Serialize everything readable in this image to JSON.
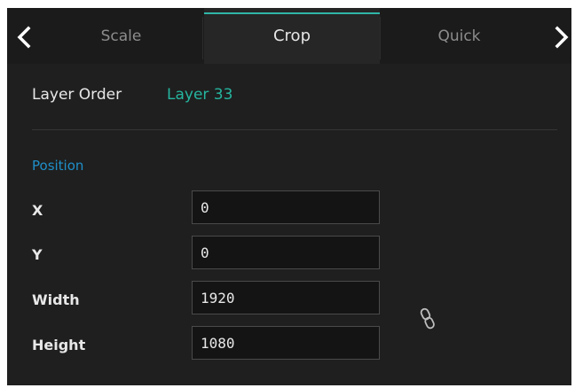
{
  "tabs": [
    {
      "label": "Scale",
      "active": false
    },
    {
      "label": "Crop",
      "active": true
    },
    {
      "label": "Quick",
      "active": false
    }
  ],
  "layer_order": {
    "label": "Layer Order",
    "value": "Layer 33"
  },
  "position": {
    "title": "Position",
    "fields": {
      "x": {
        "label": "X",
        "value": "0"
      },
      "y": {
        "label": "Y",
        "value": "0"
      },
      "width": {
        "label": "Width",
        "value": "1920"
      },
      "height": {
        "label": "Height",
        "value": "1080"
      }
    }
  },
  "icons": {
    "prev": "chevron-left-icon",
    "next": "chevron-right-icon",
    "link": "chain-link-icon"
  },
  "colors": {
    "background": "#1f1f1f",
    "tab_bar": "#1b1b1b",
    "active_tab": "#262626",
    "accent": "#2fb6a8",
    "layer_value": "#25b59f",
    "section_title": "#1f8fc9",
    "text": "#e8e8e8"
  }
}
